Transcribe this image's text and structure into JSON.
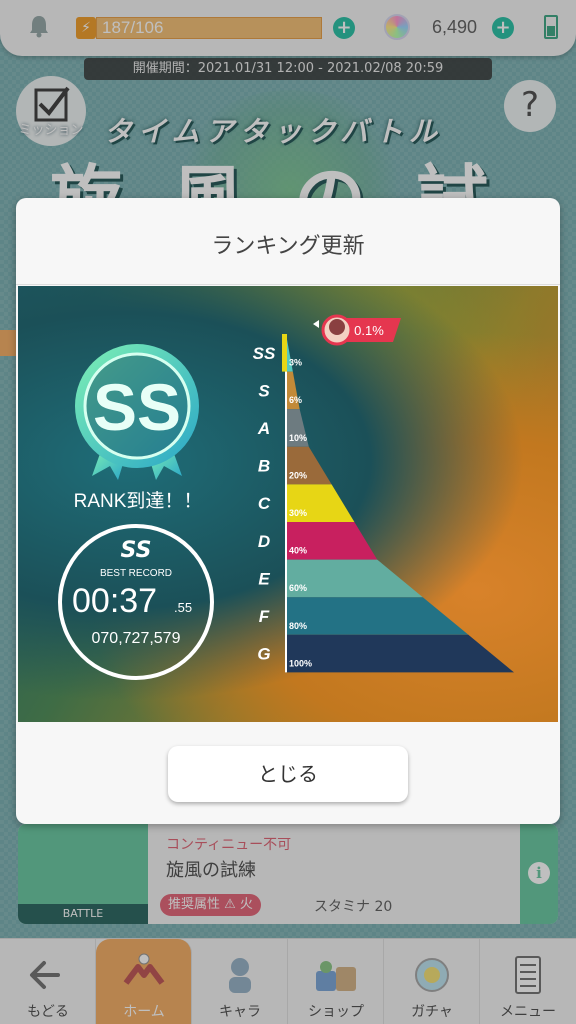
{
  "topbar": {
    "stamina": "187/106",
    "gems": "6,490",
    "period": "開催期間：2021.01/31 12:00 - 2021.02/08 20:59"
  },
  "hud": {
    "mission_label": "ミッション",
    "help_glyph": "?"
  },
  "event": {
    "subtitle": "タイムアタックバトル",
    "title": "旋風の試練"
  },
  "modal": {
    "title": "ランキング更新",
    "rank_reached": "RANK到達！！",
    "badge_rank": "SS",
    "record": {
      "rank": "SS",
      "label": "BEST RECORD",
      "time": "00:37",
      "ms": ".55",
      "score": "070,727,579"
    },
    "you_percent": "0.1%",
    "close_label": "とじる"
  },
  "chart_data": {
    "type": "bar",
    "categories": [
      "SS",
      "S",
      "A",
      "B",
      "C",
      "D",
      "E",
      "F",
      "G"
    ],
    "values": [
      3,
      6,
      10,
      20,
      30,
      40,
      60,
      80,
      100
    ],
    "value_labels": [
      "3%",
      "6%",
      "10%",
      "20%",
      "30%",
      "40%",
      "60%",
      "80%",
      "100%"
    ],
    "colors": [
      "#56c8c0",
      "#c28a38",
      "#6d7b80",
      "#9a6a3a",
      "#e7d615",
      "#c8205f",
      "#62ada0",
      "#237285",
      "#20385a"
    ],
    "current_marker": {
      "rank": "SS",
      "value": 0.1
    }
  },
  "stage_card": {
    "thumb_label": "BATTLE",
    "no_continue": "コンティニュー不可",
    "name": "旋風の試練",
    "recommended_attr": "推奨属性 ⚠ 火",
    "stamina": "スタミナ 20"
  },
  "nav": [
    {
      "label": "もどる",
      "icon": "back-arrow-icon"
    },
    {
      "label": "ホーム",
      "icon": "home-icon"
    },
    {
      "label": "キャラ",
      "icon": "character-icon"
    },
    {
      "label": "ショップ",
      "icon": "shop-icon"
    },
    {
      "label": "ガチャ",
      "icon": "gacha-icon"
    },
    {
      "label": "メニュー",
      "icon": "menu-icon"
    }
  ]
}
